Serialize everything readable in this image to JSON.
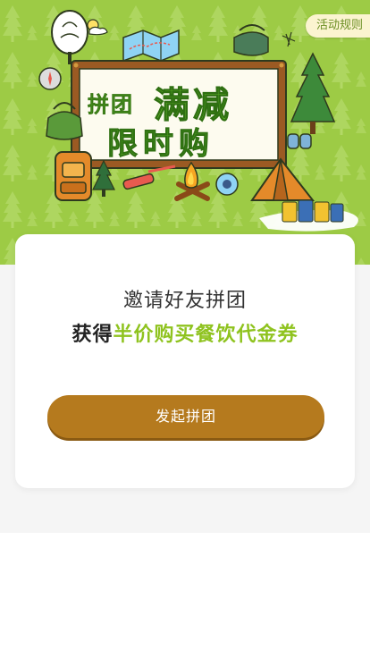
{
  "header": {
    "rules_label": "活动规则"
  },
  "banner": {
    "title_small": "拼团",
    "title_big": "满减",
    "subtitle": "限时购"
  },
  "card": {
    "invite_text": "邀请好友拼团",
    "reward_prefix": "获得",
    "reward_highlight": "半价购买餐饮代金券",
    "button_label": "发起拼团"
  },
  "colors": {
    "banner_green": "#9dcb45",
    "highlight_green": "#8fc31f",
    "button_brown": "#b57a1e"
  }
}
